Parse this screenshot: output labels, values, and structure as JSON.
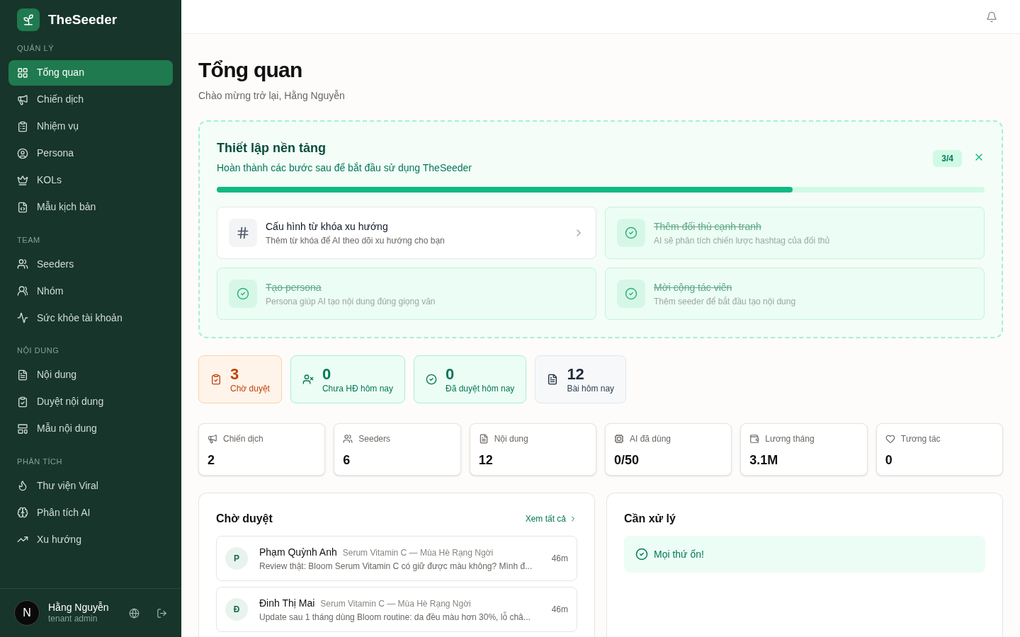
{
  "brand": {
    "name": "TheSeeder"
  },
  "sidebar": {
    "sections": [
      {
        "title": "QUẢN LÝ",
        "items": [
          {
            "label": "Tổng quan",
            "selected": true
          },
          {
            "label": "Chiến dịch",
            "selected": false
          },
          {
            "label": "Nhiệm vụ",
            "selected": false
          },
          {
            "label": "Persona",
            "selected": false
          },
          {
            "label": "KOLs",
            "selected": false
          },
          {
            "label": "Mẫu kịch bản",
            "selected": false
          }
        ]
      },
      {
        "title": "TEAM",
        "items": [
          {
            "label": "Seeders",
            "selected": false
          },
          {
            "label": "Nhóm",
            "selected": false
          },
          {
            "label": "Sức khỏe tài khoản",
            "selected": false
          }
        ]
      },
      {
        "title": "NỘI DUNG",
        "items": [
          {
            "label": "Nội dung",
            "selected": false
          },
          {
            "label": "Duyệt nội dung",
            "selected": false
          },
          {
            "label": "Mẫu nội dung",
            "selected": false
          }
        ]
      },
      {
        "title": "PHÂN TÍCH",
        "items": [
          {
            "label": "Thư viện Viral",
            "selected": false
          },
          {
            "label": "Phân tích AI",
            "selected": false
          },
          {
            "label": "Xu hướng",
            "selected": false
          }
        ]
      }
    ],
    "user": {
      "initial": "N",
      "name": "Hằng Nguyễn",
      "role": "tenant admin"
    }
  },
  "page": {
    "title": "Tổng quan",
    "subtitle": "Chào mừng trở lại, Hằng Nguyễn"
  },
  "setup": {
    "title": "Thiết lập nền tảng",
    "subtitle": "Hoàn thành các bước sau để bắt đầu sử dụng TheSeeder",
    "count": "3/4",
    "level": 0.75,
    "steps": [
      {
        "title": "Cấu hình từ khóa xu hướng",
        "description": "Thêm từ khóa để AI theo dõi xu hướng cho bạn",
        "completed": false
      },
      {
        "title": "Thêm đối thủ cạnh tranh",
        "description": "AI sẽ phân tích chiến lược hashtag của đối thủ",
        "completed": true
      },
      {
        "title": "Tạo persona",
        "description": "Persona giúp AI tạo nội dung đúng giọng văn",
        "completed": true
      },
      {
        "title": "Mời cộng tác viên",
        "description": "Thêm seeder để bắt đầu tạo nội dung",
        "completed": true
      }
    ]
  },
  "today": [
    {
      "value": "3",
      "label": "Chờ duyệt",
      "kind": "warning"
    },
    {
      "value": "0",
      "label": "Chưa HĐ hôm nay",
      "kind": "success"
    },
    {
      "value": "0",
      "label": "Đã duyệt hôm nay",
      "kind": "success"
    },
    {
      "value": "12",
      "label": "Bài hôm nay",
      "kind": "neutral"
    }
  ],
  "metrics": [
    {
      "label": "Chiến dịch",
      "value": "2"
    },
    {
      "label": "Seeders",
      "value": "6"
    },
    {
      "label": "Nội dung",
      "value": "12"
    },
    {
      "label": "AI đã dùng",
      "value": "0/50"
    },
    {
      "label": "Lương tháng",
      "value": "3.1M"
    },
    {
      "label": "Tương tác",
      "value": "0"
    }
  ],
  "pending": {
    "title": "Chờ duyệt",
    "link": "Xem tất cả",
    "items": [
      {
        "initial": "P",
        "name": "Phạm Quỳnh Anh",
        "campaign": "Serum Vitamin C — Mùa Hè Rạng Ngời",
        "excerpt": "Review thật: Bloom Serum Vitamin C có giữ được màu không? Mình đ...",
        "time": "46m"
      },
      {
        "initial": "Đ",
        "name": "Đinh Thị Mai",
        "campaign": "Serum Vitamin C — Mùa Hè Rạng Ngời",
        "excerpt": "Update sau 1 tháng dùng Bloom routine: da đều màu hơn 30%, lỗ châ...",
        "time": "46m"
      }
    ]
  },
  "todo": {
    "title": "Cần xử lý",
    "message": "Mọi thứ ổn!"
  }
}
